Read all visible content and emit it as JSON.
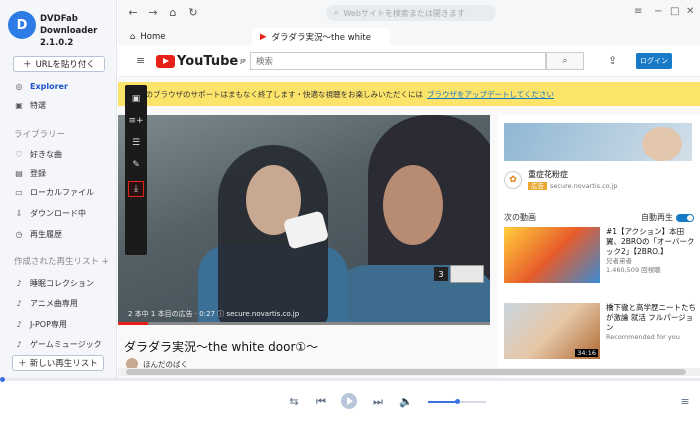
{
  "app": {
    "name_line1": "DVDFab Downloader",
    "name_line2": "2.1.0.2"
  },
  "sidebar": {
    "url_button": "URLを貼り付く",
    "items": [
      {
        "label": "Explorer",
        "icon": "compass-icon",
        "active": true
      },
      {
        "label": "特選",
        "icon": "bookmark-icon"
      }
    ],
    "library_label": "ライブラリー",
    "library_items": [
      {
        "label": "好きな曲",
        "icon": "heart-icon"
      },
      {
        "label": "登録",
        "icon": "subscribe-icon"
      },
      {
        "label": "ローカルファイル",
        "icon": "folder-icon"
      },
      {
        "label": "ダウンロード中",
        "icon": "download-icon"
      },
      {
        "label": "再生履歴",
        "icon": "history-icon"
      }
    ],
    "playlists_label": "作成された再生リスト +",
    "playlists": [
      {
        "label": "睡眠コレクション"
      },
      {
        "label": "アニメ曲専用"
      },
      {
        "label": "J-POP専用"
      },
      {
        "label": "ゲームミュージック"
      }
    ],
    "new_list_button": "新しい再生リスト"
  },
  "browser": {
    "address_placeholder": "Webサイトを検索または開きます",
    "tabs": [
      {
        "label": "Home",
        "icon": "home-icon"
      },
      {
        "label": "ダラダラ実況〜the white",
        "icon": "youtube-icon"
      }
    ]
  },
  "youtube": {
    "logo_text": "YouTube",
    "logo_sup": "JP",
    "search_placeholder": "検索",
    "login_label": "ログイン",
    "banner_text": "このブラウザのサポートはまもなく終了します・快適な視聴をお楽しみいただくには",
    "banner_link": "ブラウザをアップデートしてください",
    "video_overlay": "2 本中 1 本目の広告 · 0:27 ⓘ  secure.novartis.co.jp",
    "ad_count": "3",
    "video_title": "ダラダラ実況〜the white door①〜",
    "channel": "ほんだのばく",
    "side_ad": {
      "title": "重症花粉症",
      "badge": "広告",
      "url": "secure.novartis.co.jp"
    },
    "next_label": "次の動画",
    "autoplay_label": "自動再生",
    "related": [
      {
        "title": "#1【アクション】本田翼、2BROの「オーバークック2」【2BRO.】",
        "channel": "兄者弟者",
        "views": "1,460,509 回視聴",
        "duration": ""
      },
      {
        "title": "橋下徹と高学歴ニートたちが激論 就活 フルパージョン",
        "channel": "",
        "views": "Recommended for you",
        "duration": "34:16"
      }
    ]
  },
  "player": {
    "progress": 0
  }
}
